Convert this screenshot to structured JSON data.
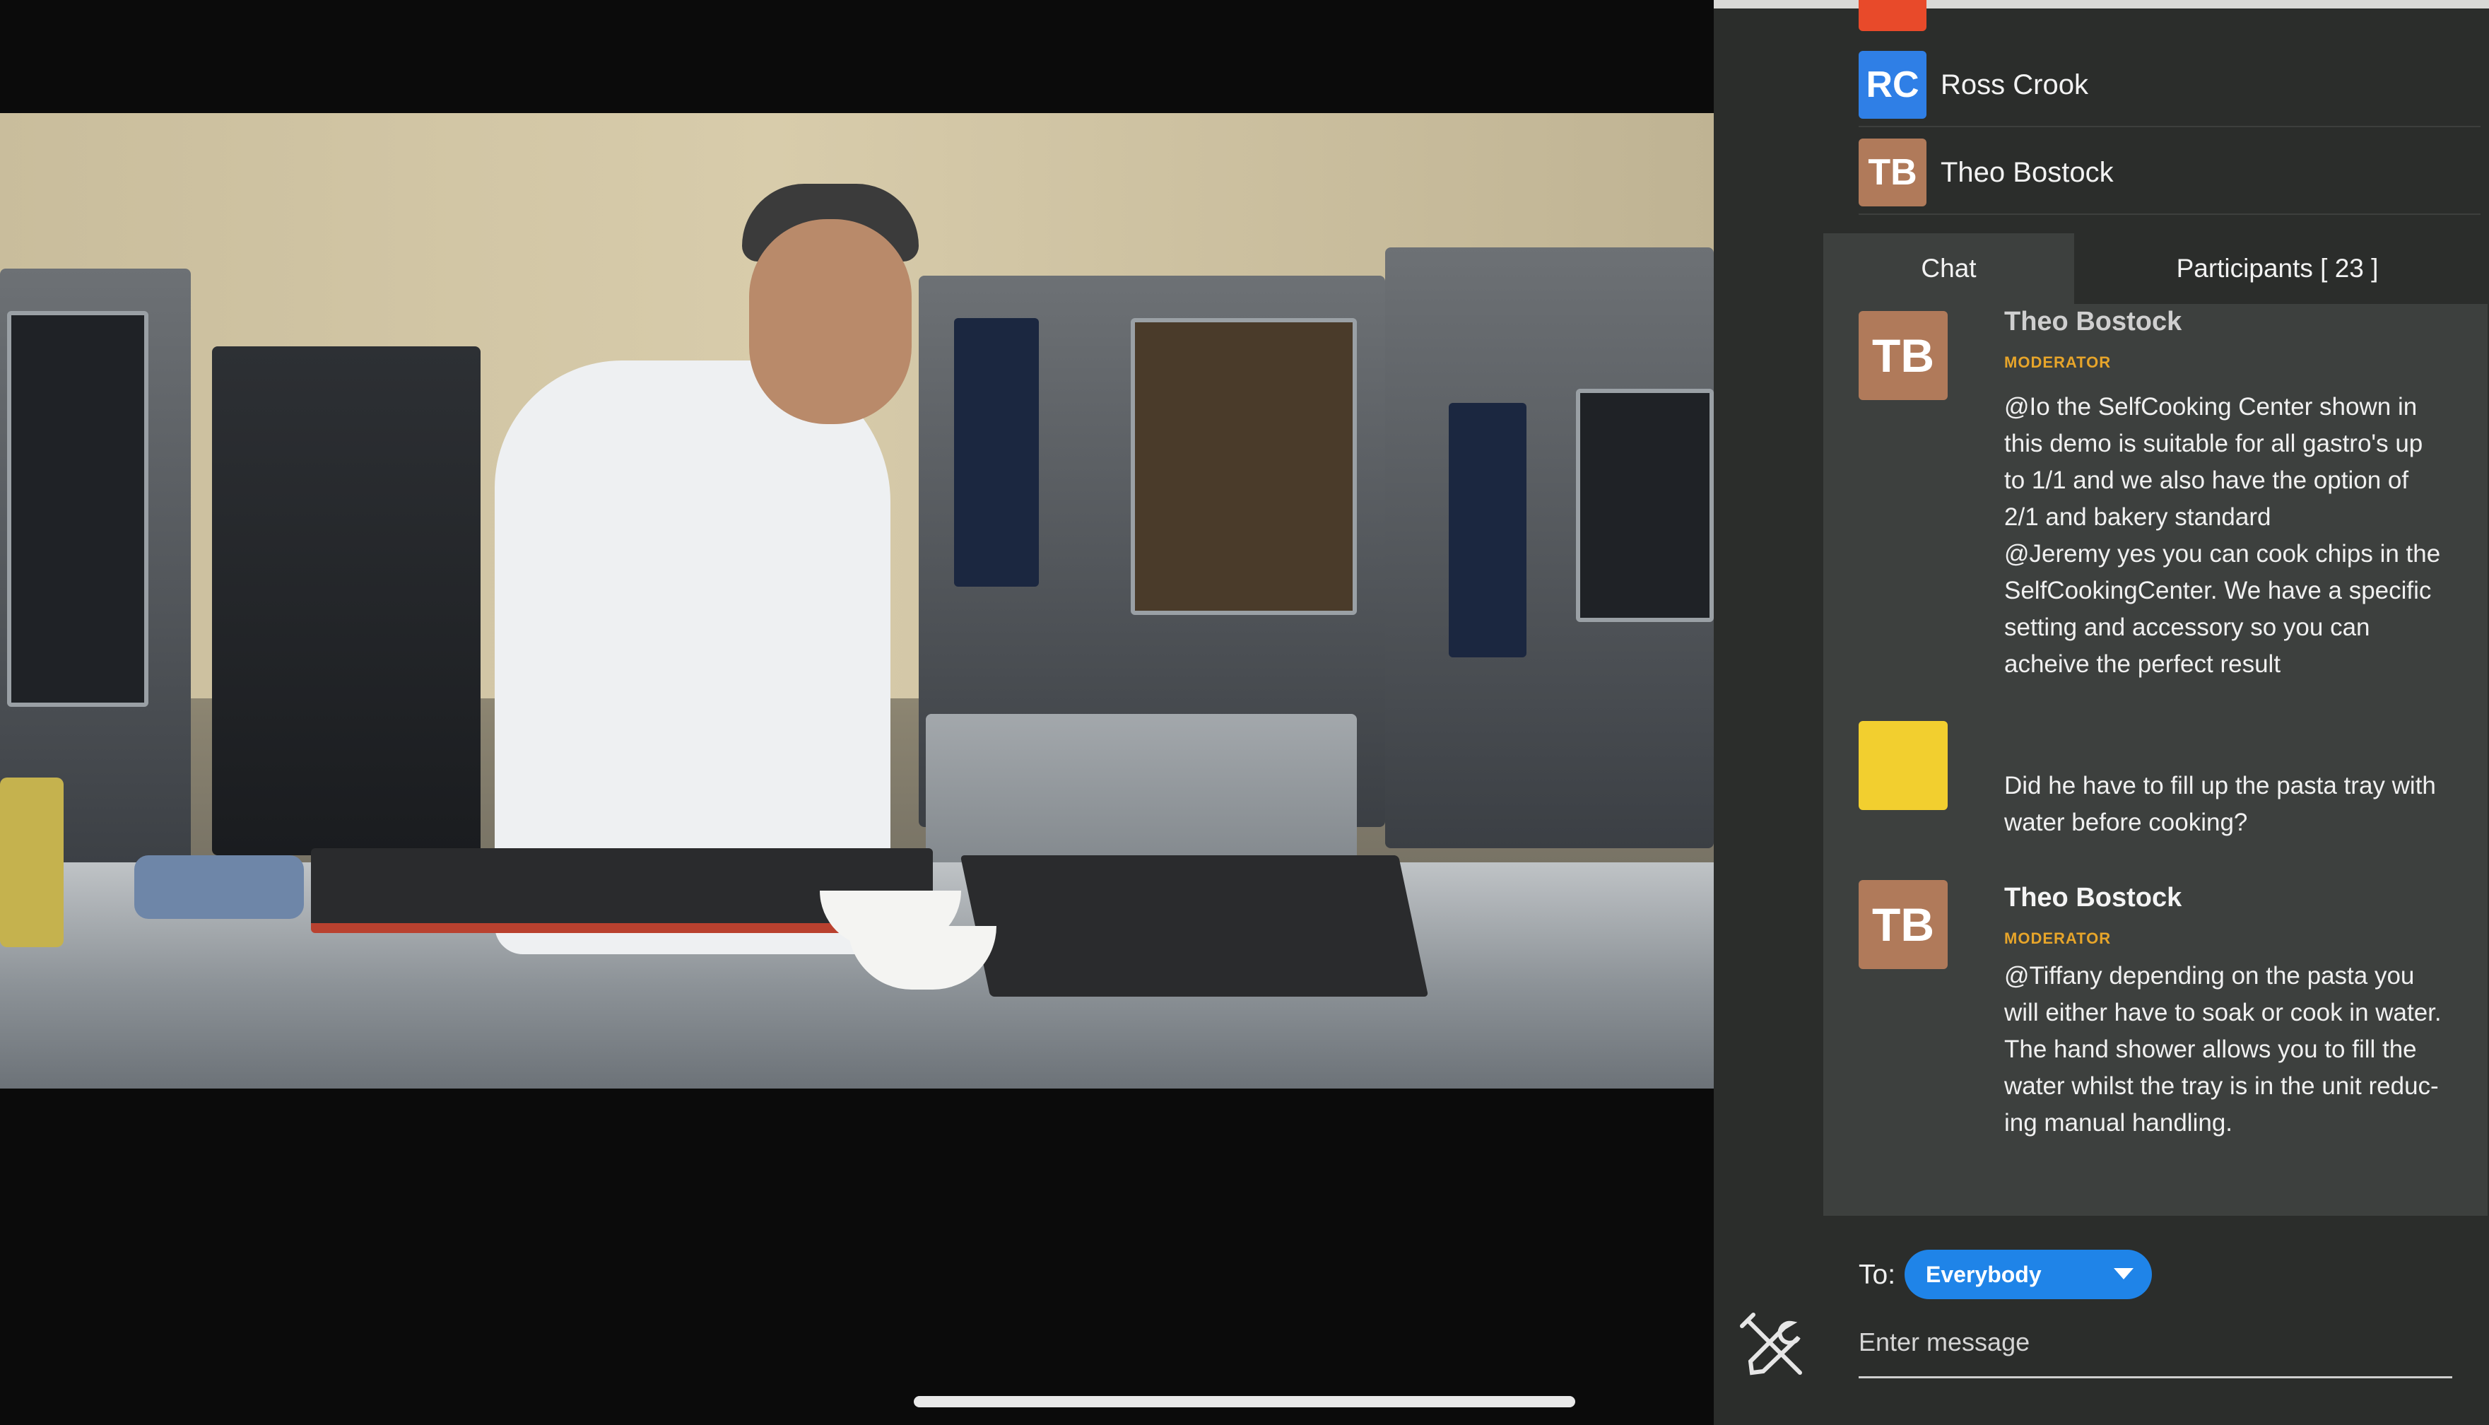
{
  "participants_list": [
    {
      "initials": "RC",
      "name": "Ross Crook",
      "color": "#2f7fe6"
    },
    {
      "initials": "TB",
      "name": "Theo Bostock",
      "color": "#b07a5a"
    }
  ],
  "tabs": {
    "chat_label": "Chat",
    "participants_label": "Participants [ 23 ]"
  },
  "chat": {
    "messages": [
      {
        "initials": "TB",
        "sender": "Theo Bostock",
        "role": "MODERATOR",
        "avatar_color": "#b07a5a",
        "lines": [
          "@Io the SelfCooking Center shown in",
          "this demo is suitable for all gastro's up",
          "to 1/1 and we also have the option of",
          "2/1 and bakery standard",
          "@Jeremy yes you can cook chips in the",
          "SelfCookingCenter. We have a specific",
          "setting and accessory so you can",
          "acheive the perfect result"
        ]
      },
      {
        "initials": "",
        "sender": "",
        "role": "",
        "avatar_color": "#f2cf2f",
        "lines": [
          "Did he have to fill up the pasta tray with",
          "water before cooking?"
        ]
      },
      {
        "initials": "TB",
        "sender": "Theo Bostock",
        "role": "MODERATOR",
        "avatar_color": "#b07a5a",
        "lines": [
          "@Tiffany depending on the pasta you",
          "will either have to soak or cook in water.",
          "The hand shower allows you to fill the",
          "water whilst the tray is in the unit reduc-",
          "ing manual handling."
        ]
      }
    ]
  },
  "compose": {
    "to_label": "To:",
    "recipient": "Everybody",
    "placeholder": "Enter message"
  },
  "icons": {
    "send": "send-arrow-icon",
    "tools": "wrench-screwdriver-icon"
  }
}
